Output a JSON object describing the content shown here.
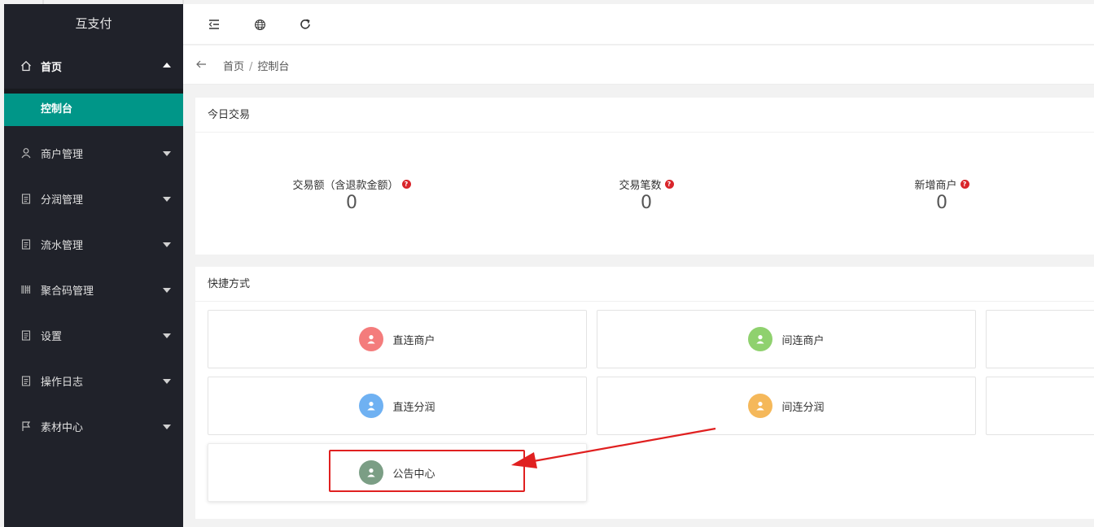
{
  "app": {
    "title": "互支付"
  },
  "sidebar": {
    "items": [
      {
        "label": "首页",
        "icon": "home-icon",
        "open": true
      },
      {
        "label": "商户管理",
        "icon": "user-icon"
      },
      {
        "label": "分润管理",
        "icon": "clipboard-icon"
      },
      {
        "label": "流水管理",
        "icon": "clipboard-icon"
      },
      {
        "label": "聚合码管理",
        "icon": "barcode-icon"
      },
      {
        "label": "设置",
        "icon": "clipboard-icon"
      },
      {
        "label": "操作日志",
        "icon": "clipboard-icon"
      },
      {
        "label": "素材中心",
        "icon": "flag-icon"
      }
    ],
    "subitems": [
      {
        "label": "控制台"
      }
    ]
  },
  "header": {
    "icons": [
      "menu-collapse-icon",
      "globe-icon",
      "refresh-icon"
    ]
  },
  "breadcrumb": {
    "home": "首页",
    "separator": "/",
    "current": "控制台"
  },
  "today": {
    "title": "今日交易",
    "help_glyph": "?",
    "stats": [
      {
        "label": "交易额（含退款金额）",
        "value": "0"
      },
      {
        "label": "交易笔数",
        "value": "0"
      },
      {
        "label": "新增商户",
        "value": "0"
      }
    ]
  },
  "shortcuts": {
    "title": "快捷方式",
    "items": [
      {
        "label": "直连商户",
        "color": "#f47c7c"
      },
      {
        "label": "间连商户",
        "color": "#8fd16e"
      },
      {
        "label": "直连分润",
        "color": "#6fb1f2"
      },
      {
        "label": "间连分润",
        "color": "#f5b85a"
      },
      {
        "label": "公告中心",
        "color": "#7b9e85"
      }
    ]
  },
  "colors": {
    "accent": "#009688",
    "sidebar_bg": "#20222a",
    "annotation": "#e02020"
  }
}
